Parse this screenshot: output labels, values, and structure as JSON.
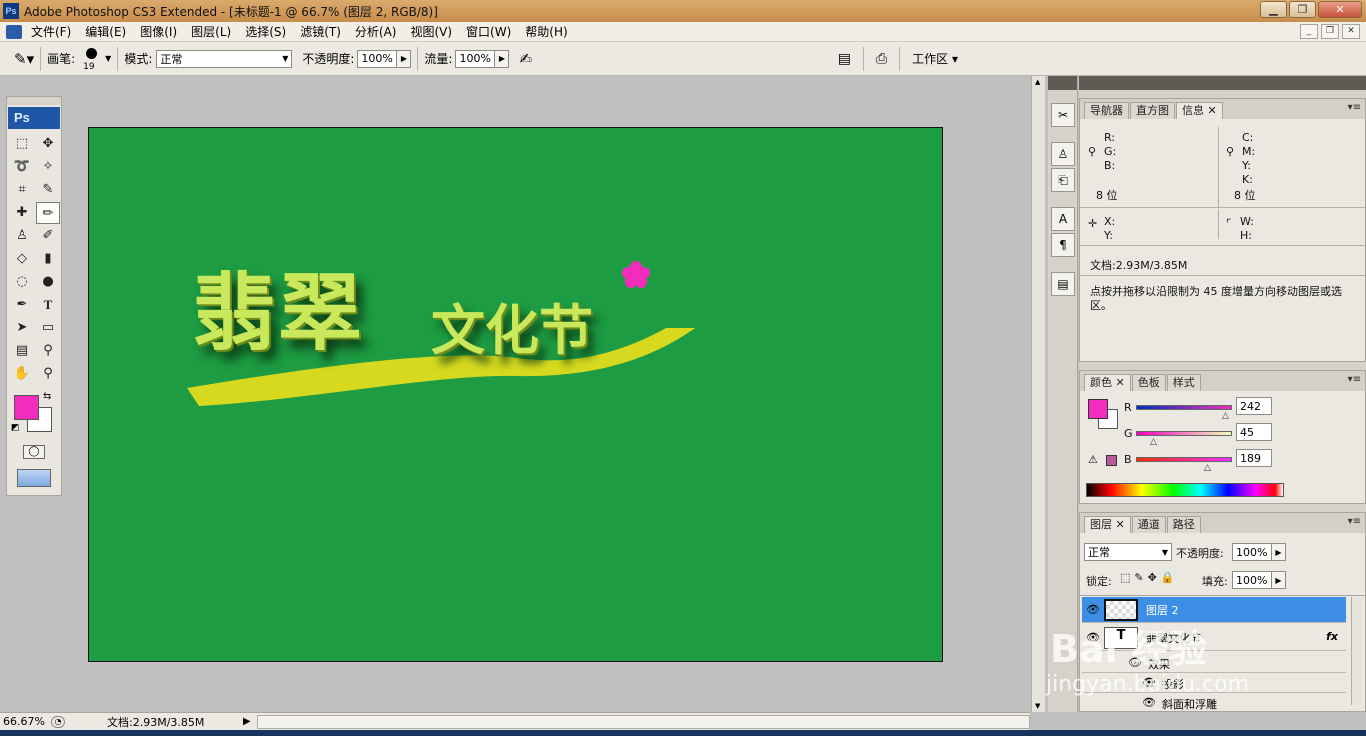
{
  "window": {
    "title": "Adobe Photoshop CS3 Extended - [未标题-1 @ 66.7% (图层 2, RGB/8)]"
  },
  "menu": [
    "文件(F)",
    "编辑(E)",
    "图像(I)",
    "图层(L)",
    "选择(S)",
    "滤镜(T)",
    "分析(A)",
    "视图(V)",
    "窗口(W)",
    "帮助(H)"
  ],
  "options": {
    "brush_label": "画笔:",
    "brush_size": "19",
    "mode_label": "模式:",
    "mode_value": "正常",
    "opacity_label": "不透明度:",
    "opacity_value": "100%",
    "flow_label": "流量:",
    "flow_value": "100%",
    "workspace": "工作区"
  },
  "toolbox": {
    "logo": "Ps",
    "fg_color": "#f22dbd",
    "bg_color": "#ffffff"
  },
  "canvas": {
    "bg_color": "#1d9c43",
    "title_big": "翡翠",
    "title_small": "文化节"
  },
  "status": {
    "zoom": "66.67%",
    "doc": "文档:2.93M/3.85M"
  },
  "info_panel": {
    "tabs": [
      "导航器",
      "直方图",
      "信息"
    ],
    "r": "R:",
    "g": "G:",
    "b": "B:",
    "c": "C:",
    "m": "M:",
    "y": "Y:",
    "k": "K:",
    "bits_left": "8 位",
    "bits_right": "8 位",
    "x": "X:",
    "yy": "Y:",
    "w": "W:",
    "h": "H:",
    "doc": "文档:2.93M/3.85M",
    "hint": "点按并拖移以沿限制为 45 度增量方向移动图层或选区。"
  },
  "color_panel": {
    "tabs": [
      "颜色",
      "色板",
      "样式"
    ],
    "r_label": "R",
    "g_label": "G",
    "b_label": "B",
    "r_value": "242",
    "g_value": "45",
    "b_value": "189"
  },
  "layers_panel": {
    "tabs": [
      "图层",
      "通道",
      "路径"
    ],
    "blend": "正常",
    "opacity_label": "不透明度:",
    "opacity": "100%",
    "lock_label": "锁定:",
    "fill_label": "填充:",
    "fill": "100%",
    "layers": [
      "图层 2",
      "翡翠文化节",
      "效果",
      "投影",
      "斜面和浮雕"
    ]
  },
  "watermark": {
    "text": "Bai 经验",
    "url": "jingyan.baidu.com"
  }
}
